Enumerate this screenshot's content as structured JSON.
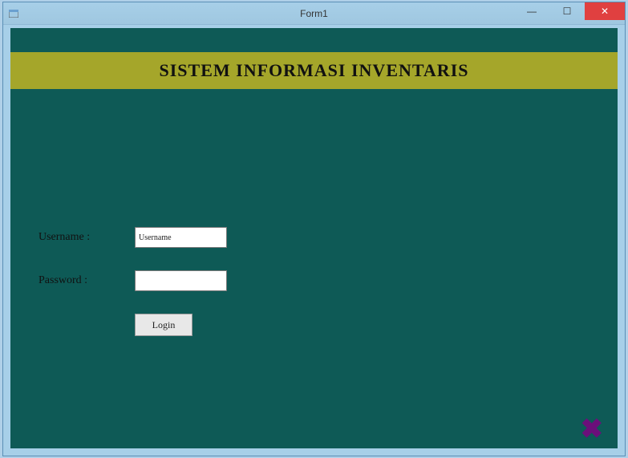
{
  "window": {
    "title": "Form1",
    "controls": {
      "minimize": "—",
      "maximize": "☐",
      "close": "✕"
    }
  },
  "header": {
    "title": "SISTEM INFORMASI INVENTARIS"
  },
  "form": {
    "username": {
      "label": "Username :",
      "value": "Username"
    },
    "password": {
      "label": "Password :",
      "value": ""
    },
    "login_label": "Login"
  },
  "footer": {
    "close_symbol": "✖"
  },
  "colors": {
    "client_bg": "#0e5a56",
    "header_band": "#a5a62a",
    "titlebar": "#a7cfe8",
    "close_btn": "#e04040",
    "close_x": "#6b0f7a"
  }
}
